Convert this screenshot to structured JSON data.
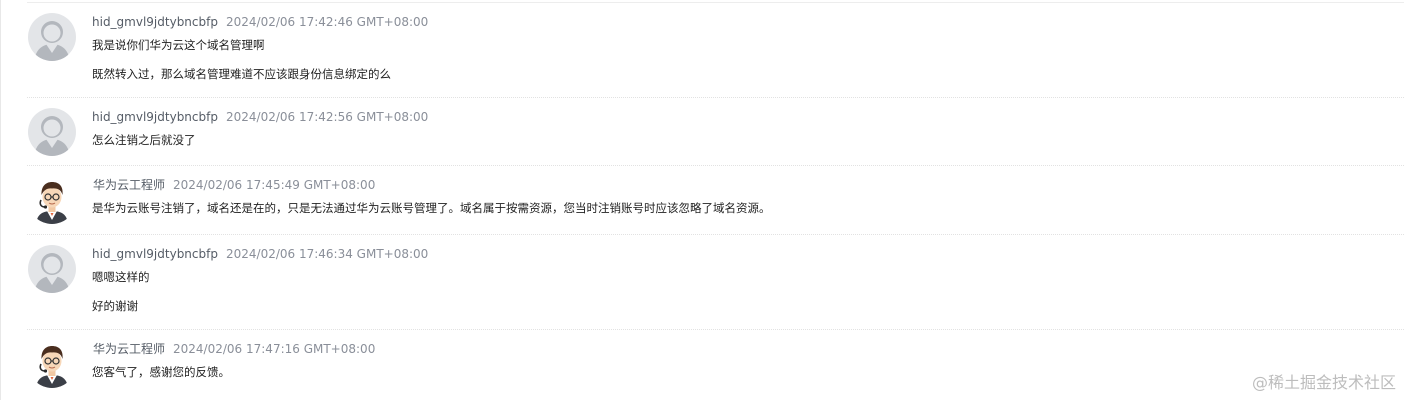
{
  "messages": [
    {
      "author": "hid_gmvl9jdtybncbfp",
      "time": "2024/02/06 17:42:46 GMT+08:00",
      "avatar_icon": "default-user-avatar-icon",
      "lines": [
        "我是说你们华为云这个域名管理啊",
        "既然转入过，那么域名管理难道不应该跟身份信息绑定的么"
      ]
    },
    {
      "author": "hid_gmvl9jdtybncbfp",
      "time": "2024/02/06 17:42:56 GMT+08:00",
      "avatar_icon": "default-user-avatar-icon",
      "lines": [
        "怎么注销之后就没了"
      ]
    },
    {
      "author": "华为云工程师",
      "time": "2024/02/06 17:45:49 GMT+08:00",
      "avatar_icon": "engineer-avatar-icon",
      "lines": [
        "是华为云账号注销了，域名还是在的，只是无法通过华为云账号管理了。域名属于按需资源，您当时注销账号时应该忽略了域名资源。"
      ]
    },
    {
      "author": "hid_gmvl9jdtybncbfp",
      "time": "2024/02/06 17:46:34 GMT+08:00",
      "avatar_icon": "default-user-avatar-icon",
      "lines": [
        "嗯嗯这样的",
        "好的谢谢"
      ]
    },
    {
      "author": "华为云工程师",
      "time": "2024/02/06 17:47:16 GMT+08:00",
      "avatar_icon": "engineer-avatar-icon",
      "lines": [
        "您客气了，感谢您的反馈。"
      ]
    }
  ],
  "watermark": "@稀土掘金技术社区",
  "colors": {
    "author": "#555c66",
    "time": "#8a8f99",
    "text": "#222222",
    "divider": "#e2e2e2",
    "default_avatar_bg": "#e3e5e8",
    "default_avatar_fg": "#b3b7bd"
  }
}
